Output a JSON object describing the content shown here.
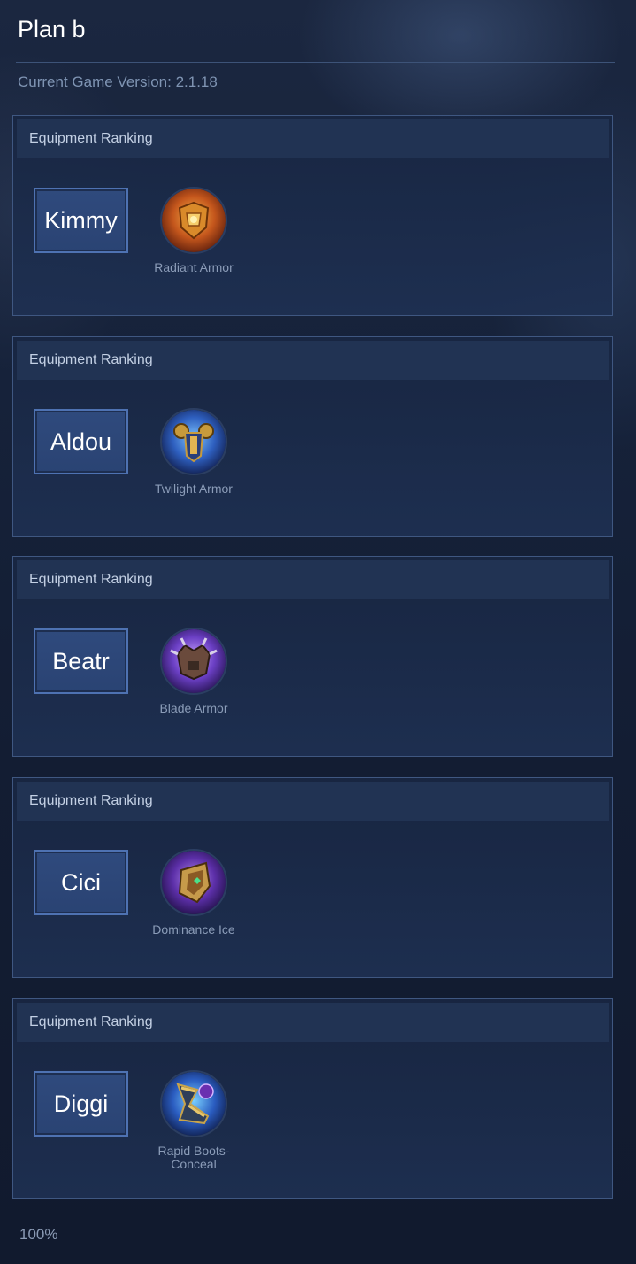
{
  "header": {
    "title": "Plan b",
    "version_text": "Current Game Version: 2.1.18"
  },
  "cards": [
    {
      "section_label": "Equipment Ranking",
      "hero": "Kimmy",
      "item": {
        "name": "Radiant Armor",
        "icon": "radiant-armor-icon"
      }
    },
    {
      "section_label": "Equipment Ranking",
      "hero": "Aldou",
      "item": {
        "name": "Twilight Armor",
        "icon": "twilight-armor-icon"
      }
    },
    {
      "section_label": "Equipment Ranking",
      "hero": "Beatr",
      "item": {
        "name": "Blade Armor",
        "icon": "blade-armor-icon"
      }
    },
    {
      "section_label": "Equipment Ranking",
      "hero": "Cici",
      "item": {
        "name": "Dominance Ice",
        "icon": "dominance-ice-icon"
      }
    },
    {
      "section_label": "Equipment Ranking",
      "hero": "Diggi",
      "item": {
        "name": "Rapid Boots-Conceal",
        "icon": "rapid-boots-conceal-icon"
      }
    }
  ],
  "footer": {
    "progress_text": "100%"
  }
}
